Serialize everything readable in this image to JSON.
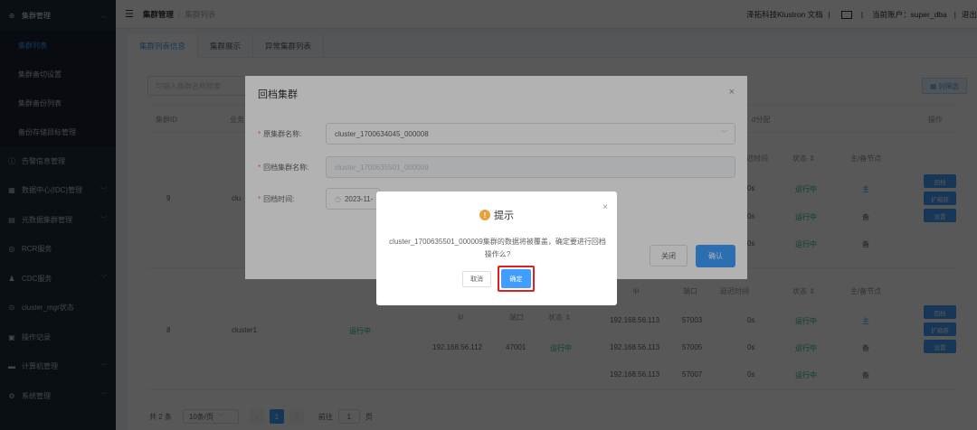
{
  "sidebar": {
    "group_title": "集群管理",
    "sub_items": [
      {
        "label": "集群列表",
        "active": true
      },
      {
        "label": "集群备切设置"
      },
      {
        "label": "集群备份列表"
      },
      {
        "label": "备份存储目标管理"
      }
    ],
    "items": [
      {
        "label": "告警信息管理",
        "icon": "info-circle-icon"
      },
      {
        "label": "数据中心(IDC)管理",
        "icon": "datacenter-icon"
      },
      {
        "label": "元数据集群管理",
        "icon": "metadata-icon"
      },
      {
        "label": "RCR服务",
        "icon": "rcr-icon"
      },
      {
        "label": "CDC服务",
        "icon": "user-icon"
      },
      {
        "label": "cluster_mgr状态",
        "icon": "status-icon"
      },
      {
        "label": "操作记录",
        "icon": "record-icon"
      },
      {
        "label": "计算机管理",
        "icon": "computer-icon"
      },
      {
        "label": "系统管理",
        "icon": "settings-icon"
      }
    ]
  },
  "topbar": {
    "crumb1": "集群管理",
    "crumb2": "集群列表",
    "brand": "泽拓科技Klustron 文档",
    "sep": "|",
    "account": "当前账户：super_dba",
    "logout": "退出"
  },
  "tabs": [
    "集群列表信息",
    "集群展示",
    "异常集群列表"
  ],
  "search": {
    "placeholder": "可输入集群名称搜索"
  },
  "col_filter": "列筛选",
  "table": {
    "headers": {
      "id": "集群ID",
      "business": "业务",
      "shard_dist": "d分配",
      "op": "操作"
    },
    "row1": {
      "id": "9",
      "name": "clu"
    },
    "row2": {
      "id": "8",
      "name": "cluster1",
      "status": "运行中"
    },
    "inner_right_headers": {
      "time": "延迟时间",
      "status": "状态",
      "node": "主/备节点"
    },
    "inner_right_rows_1": [
      {
        "time": "0s",
        "status": "运行中",
        "node": "主"
      },
      {
        "time": "0s",
        "status": "运行中",
        "node": "备"
      },
      {
        "time": "0s",
        "status": "运行中",
        "node": "备"
      }
    ],
    "inner_mid_headers": {
      "ip": "ip",
      "port": "端口",
      "status": "状态"
    },
    "inner_mid_row": {
      "ip": "192.168.56.112",
      "port": "47001",
      "status": "运行中"
    },
    "inner_right_headers_2": {
      "ip": "ip",
      "port": "端口",
      "time": "延迟时间",
      "status": "状态",
      "node": "主/备节点"
    },
    "inner_right_rows_2": [
      {
        "ip": "192.168.56.113",
        "port": "57003",
        "time": "0s",
        "status": "运行中",
        "node": "主"
      },
      {
        "ip": "192.168.56.113",
        "port": "57005",
        "time": "0s",
        "status": "运行中",
        "node": "备"
      },
      {
        "ip": "192.168.56.113",
        "port": "57007",
        "time": "0s",
        "status": "运行中",
        "node": "备"
      }
    ],
    "op_buttons": [
      "回档",
      "扩缩容",
      "设置"
    ]
  },
  "pagination": {
    "total": "共 2 条",
    "page_size": "10条/页",
    "prev": "‹",
    "current": "1",
    "next": "›",
    "goto_label": "前往",
    "goto_value": "1",
    "page_unit": "页"
  },
  "rollback_dialog": {
    "title": "回档集群",
    "close": "×",
    "src_label": "原集群名称:",
    "src_value": "cluster_1700634045_000008",
    "dst_label": "回档集群名称:",
    "dst_value": "cluster_1700635501_000009",
    "time_label": "回档时间:",
    "time_value": "2023-11-",
    "close_btn": "关闭",
    "ok_btn": "确认"
  },
  "message_box": {
    "title": "提示",
    "icon": "warning-icon",
    "close": "×",
    "text": "cluster_1700635501_000009集群的数据将被覆盖，确定要进行回档操作么?",
    "cancel": "取消",
    "confirm": "确定"
  }
}
